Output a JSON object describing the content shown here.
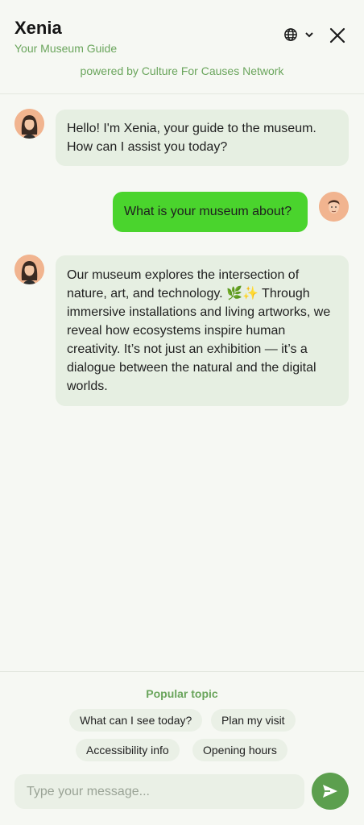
{
  "header": {
    "title": "Xenia",
    "subtitle": "Your Museum Guide",
    "powered_by": "powered by Culture For Causes Network",
    "language_icon": "globe-icon",
    "dropdown_icon": "chevron-down-icon",
    "close_icon": "close-icon"
  },
  "messages": [
    {
      "role": "assistant",
      "avatar": "guide-avatar",
      "text": "Hello! I'm Xenia, your guide to the museum. How can I assist you today?"
    },
    {
      "role": "user",
      "avatar": "user-avatar",
      "text": "What is your museum about?"
    },
    {
      "role": "assistant",
      "avatar": "guide-avatar",
      "text": "Our museum explores the intersection of nature, art, and technology. 🌿✨ Through immersive installations and living artworks, we reveal how ecosystems inspire human creativity. It’s not just an exhibition — it’s a dialogue between the natural and the digital worlds."
    }
  ],
  "popular": {
    "title": "Popular topic",
    "chips": [
      "What can I see today?",
      "Plan my visit",
      "Accessibility info",
      "Opening hours"
    ]
  },
  "composer": {
    "placeholder": "Type your message...",
    "send_icon": "send-icon"
  },
  "colors": {
    "accent": "#6aa55c",
    "user_bubble": "#4ad42d",
    "bot_bubble": "#e6efe2",
    "send_button": "#5c9f4e",
    "background": "#f6f8f3"
  }
}
